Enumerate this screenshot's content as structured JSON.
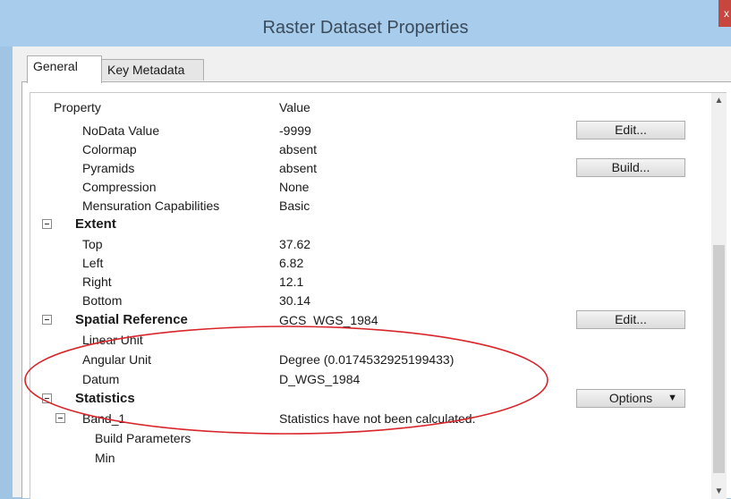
{
  "window": {
    "title": "Raster Dataset Properties",
    "close_label": "x"
  },
  "tabs": [
    {
      "label": "General",
      "active": true
    },
    {
      "label": "Key Metadata",
      "active": false
    }
  ],
  "table": {
    "header": {
      "property": "Property",
      "value": "Value"
    },
    "rows": [
      {
        "property": "NoData Value",
        "value": "-9999",
        "button": "Edit..."
      },
      {
        "property": "Colormap",
        "value": "absent"
      },
      {
        "property": "Pyramids",
        "value": "absent",
        "button": "Build..."
      },
      {
        "property": "Compression",
        "value": "None"
      },
      {
        "property": "Mensuration Capabilities",
        "value": "Basic"
      },
      {
        "property": "Extent",
        "value": ""
      },
      {
        "property": "Top",
        "value": "37.62"
      },
      {
        "property": "Left",
        "value": "6.82"
      },
      {
        "property": "Right",
        "value": "12.1"
      },
      {
        "property": "Bottom",
        "value": "30.14"
      },
      {
        "property": "Spatial Reference",
        "value": "GCS_WGS_1984",
        "button": "Edit..."
      },
      {
        "property": "Linear Unit",
        "value": ""
      },
      {
        "property": "Angular Unit",
        "value": "Degree (0.0174532925199433)"
      },
      {
        "property": "Datum",
        "value": "D_WGS_1984"
      },
      {
        "property": "Statistics",
        "value": "",
        "button": "Options"
      },
      {
        "property": "Band_1",
        "value": "Statistics have not been calculated."
      },
      {
        "property": "Build Parameters",
        "value": ""
      },
      {
        "property": "Min",
        "value": ""
      }
    ]
  },
  "colors": {
    "title_bar": "#a8cdec",
    "close_button": "#c7463e",
    "annotation_ellipse": "#d9252a"
  },
  "icons": {
    "collapse": "minus-box-icon",
    "dropdown": "triangle-down-icon",
    "scroll_up": "chevron-up-icon",
    "scroll_down": "chevron-down-icon"
  }
}
